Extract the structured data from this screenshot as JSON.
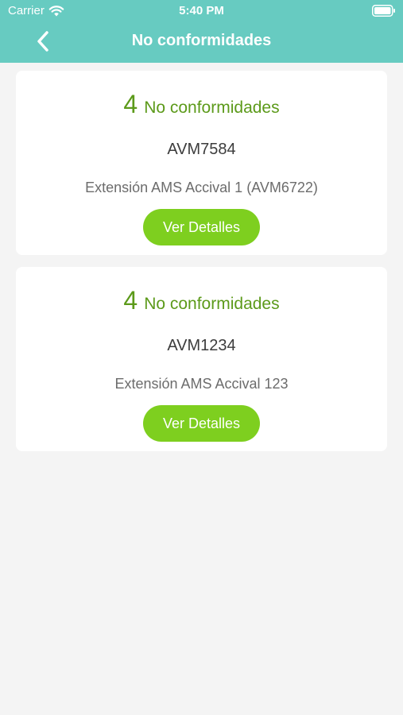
{
  "status_bar": {
    "carrier": "Carrier",
    "time": "5:40 PM",
    "wifi_icon": "wifi-icon",
    "battery_icon": "battery-icon"
  },
  "nav": {
    "back_icon": "chevron-left-icon",
    "title": "No conformidades"
  },
  "colors": {
    "header": "#67cbc1",
    "accent_text": "#5c9a1a",
    "button": "#7ecf1f",
    "background": "#f4f4f4"
  },
  "cards": [
    {
      "count": "4",
      "count_label": "No conformidades",
      "code": "AVM7584",
      "description": "Extensión AMS Accival 1 (AVM6722)",
      "button_label": "Ver Detalles"
    },
    {
      "count": "4",
      "count_label": "No conformidades",
      "code": "AVM1234",
      "description": "Extensión AMS Accival 123",
      "button_label": "Ver Detalles"
    }
  ]
}
